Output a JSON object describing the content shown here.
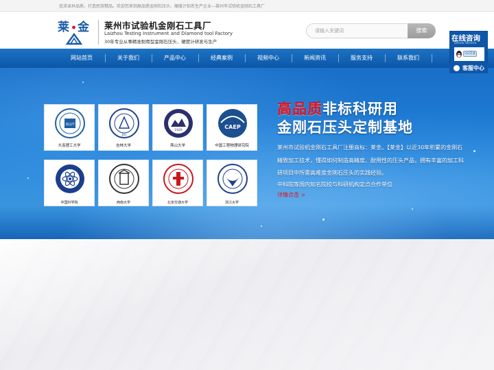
{
  "topbar": {
    "text": "追求卓异品质，打造民族精品。欢迎您来到高品质金刚石压头、硬度计知名生产企业—莱州市试验机金刚石工具厂"
  },
  "header": {
    "logo_text_left": "莱",
    "logo_text_right": "金",
    "brand_cn": "莱州市试验机金刚石工具厂",
    "brand_en": "Laizhou Testing Instrument and Diamond tool Factory",
    "slogan": "30年专业从事精准耐用型金刚石压头、硬度计研发与生产"
  },
  "search": {
    "placeholder": "请输入关键词",
    "button_label": "搜索"
  },
  "nav": {
    "items": [
      {
        "label": "网站首页"
      },
      {
        "label": "关于我们"
      },
      {
        "label": "产品中心"
      },
      {
        "label": "经典案例"
      },
      {
        "label": "视频中心"
      },
      {
        "label": "新闻资讯"
      },
      {
        "label": "服务支持"
      },
      {
        "label": "联系我们"
      }
    ]
  },
  "partners": [
    {
      "name": "大连理工大学",
      "logo_text": "DLUT"
    },
    {
      "name": "吉林大学",
      "logo_text": "JLU"
    },
    {
      "name": "燕山大学",
      "logo_text": "1920"
    },
    {
      "name": "中国工程物理研究院",
      "logo_text": "CAEP"
    },
    {
      "name": "中国科学院",
      "logo_text": ""
    },
    {
      "name": "西南大学",
      "logo_text": ""
    },
    {
      "name": "北京交通大学",
      "logo_text": ""
    },
    {
      "name": "浙江大学",
      "logo_text": ""
    }
  ],
  "hero": {
    "title1_red": "高品质",
    "title1_rest": "非标科研用",
    "title2": "金刚石压头定制基地",
    "desc1": "莱州市试验机金刚石工具厂注册商标：莱金。【莱金】以近30年积累的金刚石精致加工技术，懂得如何制造高精度、耐用性的压头产品，拥有丰富的加工科研项目中所需高难度金刚石压头的实践经验。",
    "desc2": "中科院等国内知名院校与科研机构定点合作单位",
    "more": "详情点击 >"
  },
  "online": {
    "title": "在线咨询",
    "subtitle": "Online Service",
    "qq_label": "QQ交谈",
    "kefu": "客服中心"
  },
  "colors": {
    "nav_blue": "#1d73c4",
    "accent_red": "#e3121b",
    "logo_blue": "#1a5aa8"
  }
}
